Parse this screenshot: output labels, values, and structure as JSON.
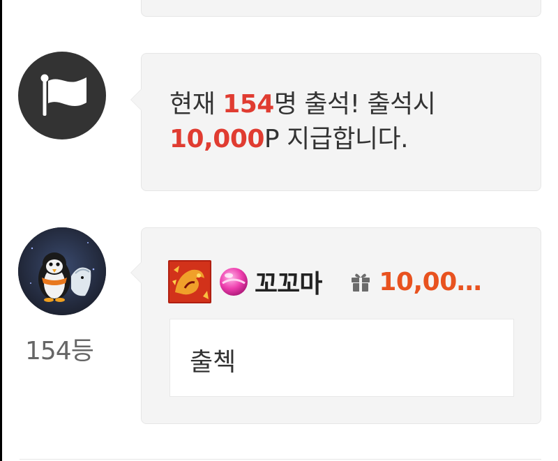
{
  "notice": {
    "prefix": "현재 ",
    "count": "154",
    "count_suffix": "명 출석! 출석시",
    "points": "10,000",
    "points_suffix": "P 지급합니다."
  },
  "comment": {
    "rank": "154등",
    "nickname": "꼬꼬마",
    "gift_amount": "10,00…",
    "text": "출첵"
  },
  "icons": {
    "notice_avatar": "flag-icon",
    "user_avatar": "penguin-avatar",
    "badge_1": "dragon-badge-icon",
    "badge_2": "candy-badge-icon",
    "gift": "gift-icon"
  },
  "colors": {
    "highlight": "#e03c31",
    "gift_amount": "#e8521f",
    "bubble_bg": "#f4f4f4",
    "avatar_bg": "#333333"
  }
}
